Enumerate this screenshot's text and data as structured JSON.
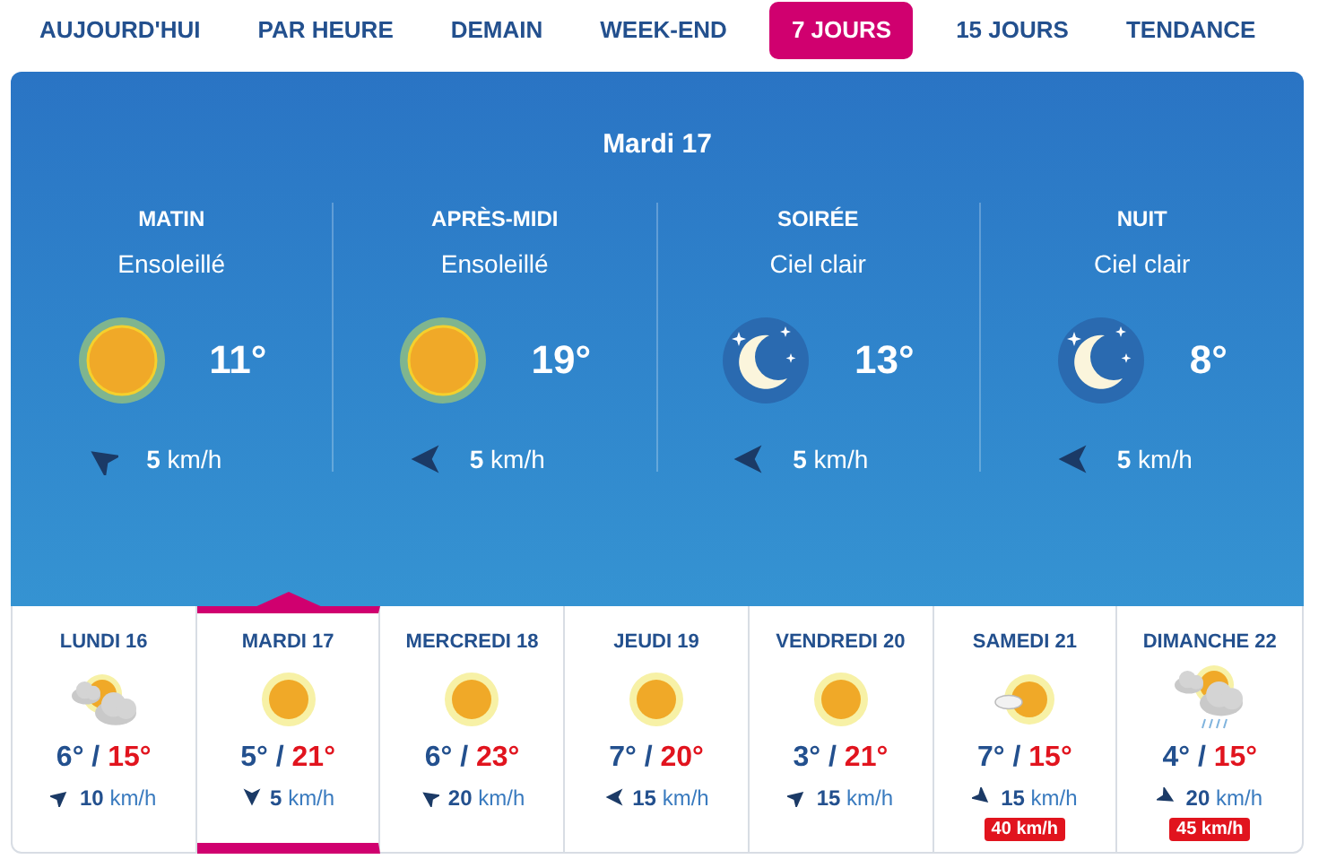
{
  "tabs": [
    {
      "label": "AUJOURD'HUI",
      "selected": false
    },
    {
      "label": "PAR HEURE",
      "selected": false
    },
    {
      "label": "DEMAIN",
      "selected": false
    },
    {
      "label": "WEEK-END",
      "selected": false
    },
    {
      "label": "7 JOURS",
      "selected": true
    },
    {
      "label": "15 JOURS",
      "selected": false
    },
    {
      "label": "TENDANCE",
      "selected": false
    }
  ],
  "detail": {
    "title": "Mardi 17",
    "periods": [
      {
        "name": "MATIN",
        "condition": "Ensoleillé",
        "kind": "sun",
        "temp": "11°",
        "wind_speed": "5",
        "wind_unit": "km/h"
      },
      {
        "name": "APRÈS-MIDI",
        "condition": "Ensoleillé",
        "kind": "sun",
        "temp": "19°",
        "wind_speed": "5",
        "wind_unit": "km/h"
      },
      {
        "name": "SOIRÉE",
        "condition": "Ciel clair",
        "kind": "moon",
        "temp": "13°",
        "wind_speed": "5",
        "wind_unit": "km/h"
      },
      {
        "name": "NUIT",
        "condition": "Ciel clair",
        "kind": "moon",
        "temp": "8°",
        "wind_speed": "5",
        "wind_unit": "km/h"
      }
    ]
  },
  "days": [
    {
      "label": "LUNDI 16",
      "kind": "cloudy",
      "min": "6°",
      "separator": "/",
      "max": "15°",
      "wind_speed": "10",
      "wind_unit": "km/h",
      "selected": false
    },
    {
      "label": "MARDI 17",
      "kind": "sun",
      "min": "5°",
      "separator": "/",
      "max": "21°",
      "wind_speed": "5",
      "wind_unit": "km/h",
      "selected": true
    },
    {
      "label": "MERCREDI 18",
      "kind": "sun",
      "min": "6°",
      "separator": "/",
      "max": "23°",
      "wind_speed": "20",
      "wind_unit": "km/h",
      "selected": false
    },
    {
      "label": "JEUDI 19",
      "kind": "sun",
      "min": "7°",
      "separator": "/",
      "max": "20°",
      "wind_speed": "15",
      "wind_unit": "km/h",
      "selected": false
    },
    {
      "label": "VENDREDI 20",
      "kind": "sun",
      "min": "3°",
      "separator": "/",
      "max": "21°",
      "wind_speed": "15",
      "wind_unit": "km/h",
      "selected": false
    },
    {
      "label": "SAMEDI 21",
      "kind": "partly",
      "min": "7°",
      "separator": "/",
      "max": "15°",
      "wind_speed": "15",
      "wind_unit": "km/h",
      "gust": "40 km/h",
      "selected": false
    },
    {
      "label": "DIMANCHE 22",
      "kind": "rain",
      "min": "4°",
      "separator": "/",
      "max": "15°",
      "wind_speed": "20",
      "wind_unit": "km/h",
      "gust": "45 km/h",
      "selected": false
    }
  ]
}
